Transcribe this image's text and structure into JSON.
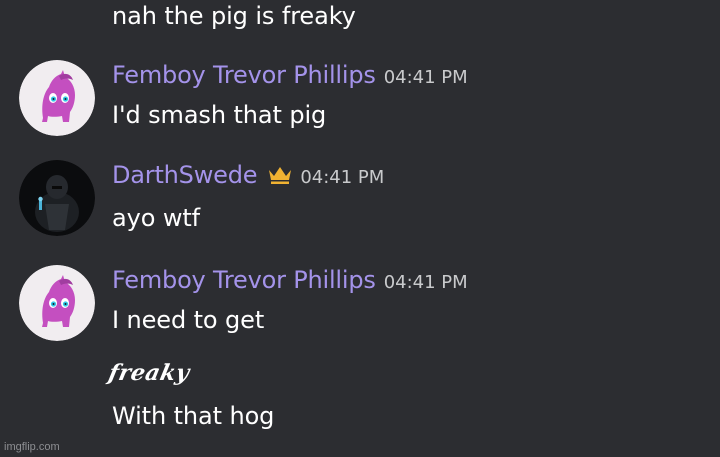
{
  "colors": {
    "background": "#2c2d31",
    "message_text": "#ffffff",
    "timestamp_text": "#c9cacc",
    "author_femboy": "#a493ea",
    "author_darth": "#a493ea",
    "crown": "#f0b232",
    "watermark": "#8d8e92"
  },
  "messages": [
    {
      "text": "nah the pig is freaky"
    },
    {
      "author": "Femboy Trevor Phillips",
      "timestamp": "04:41 PM",
      "avatar_icon": "pink-pony-avatar-icon",
      "text": "I'd smash that pig"
    },
    {
      "author": "DarthSwede",
      "timestamp": "04:41 PM",
      "avatar_icon": "dark-armored-figure-avatar-icon",
      "badge_icon": "crown-icon",
      "text": "ayo wtf"
    },
    {
      "author": "Femboy Trevor Phillips",
      "timestamp": "04:41 PM",
      "avatar_icon": "pink-pony-avatar-icon",
      "lines": [
        "I need to get",
        "freaky",
        "With that hog"
      ]
    }
  ],
  "watermark": "imgflip.com"
}
